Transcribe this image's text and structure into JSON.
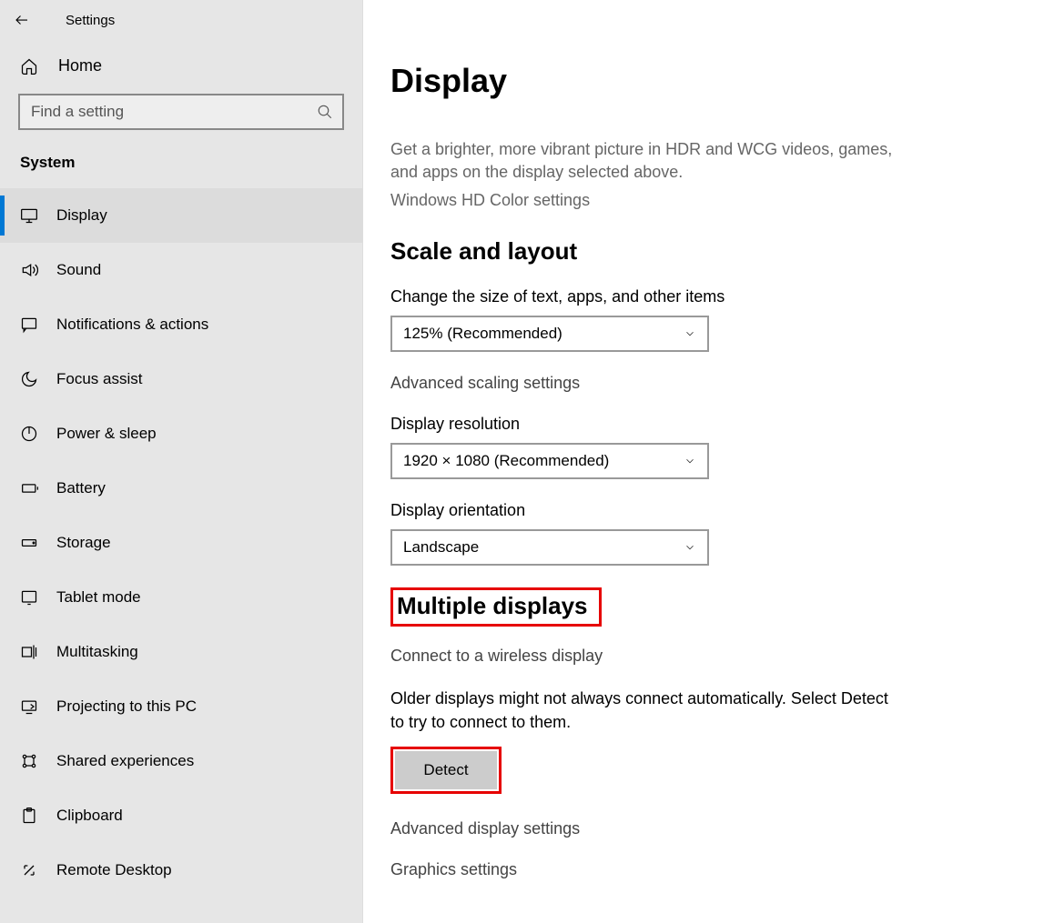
{
  "window": {
    "title": "Settings"
  },
  "sidebar": {
    "home": "Home",
    "search_placeholder": "Find a setting",
    "section": "System",
    "items": [
      {
        "label": "Display"
      },
      {
        "label": "Sound"
      },
      {
        "label": "Notifications & actions"
      },
      {
        "label": "Focus assist"
      },
      {
        "label": "Power & sleep"
      },
      {
        "label": "Battery"
      },
      {
        "label": "Storage"
      },
      {
        "label": "Tablet mode"
      },
      {
        "label": "Multitasking"
      },
      {
        "label": "Projecting to this PC"
      },
      {
        "label": "Shared experiences"
      },
      {
        "label": "Clipboard"
      },
      {
        "label": "Remote Desktop"
      }
    ]
  },
  "main": {
    "title": "Display",
    "hdr_desc": "Get a brighter, more vibrant picture in HDR and WCG videos, games, and apps on the display selected above.",
    "hdr_link": "Windows HD Color settings",
    "scale": {
      "heading": "Scale and layout",
      "size_label": "Change the size of text, apps, and other items",
      "size_value": "125% (Recommended)",
      "adv_scaling": "Advanced scaling settings",
      "res_label": "Display resolution",
      "res_value": "1920 × 1080 (Recommended)",
      "orient_label": "Display orientation",
      "orient_value": "Landscape"
    },
    "multi": {
      "heading": "Multiple displays",
      "wireless": "Connect to a wireless display",
      "desc": "Older displays might not always connect automatically. Select Detect to try to connect to them.",
      "detect": "Detect",
      "adv": "Advanced display settings",
      "graphics": "Graphics settings"
    }
  }
}
